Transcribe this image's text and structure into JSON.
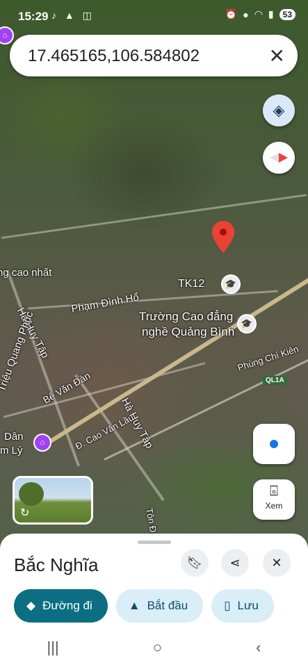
{
  "status": {
    "time": "15:29",
    "battery": "53"
  },
  "search": {
    "query": "17.465165,106.584802"
  },
  "map": {
    "labels": {
      "cao_nhat": "ng cao nhất",
      "ha_huy_tap_1": "Hà Huy Tập",
      "pham_dinh_ho": "Phạm Đình Hổ",
      "tk12": "TK12",
      "truong_line1": "Trường Cao đẳng",
      "truong_line2": "nghề Quảng Bình",
      "phung_chi_kien": "Phùng Chí Kiên",
      "trieu_quang_phuc": "Triệu Quang Phục",
      "be_van_dan": "Bế Văn Đàn",
      "ha_huy_tap_2": "Hà Huy Tập",
      "cao_van_lau": "Đ. Cao Văn Lầu",
      "dan": "Dân",
      "m_ly": "m Lý",
      "ton": "Tôn Đ",
      "route": "QL1A"
    }
  },
  "controls": {
    "xem_label": "Xem"
  },
  "sheet": {
    "place": "Bắc Nghĩa",
    "chips": [
      {
        "label": "Đường đi"
      },
      {
        "label": "Bắt đầu"
      },
      {
        "label": "Lưu"
      }
    ]
  }
}
